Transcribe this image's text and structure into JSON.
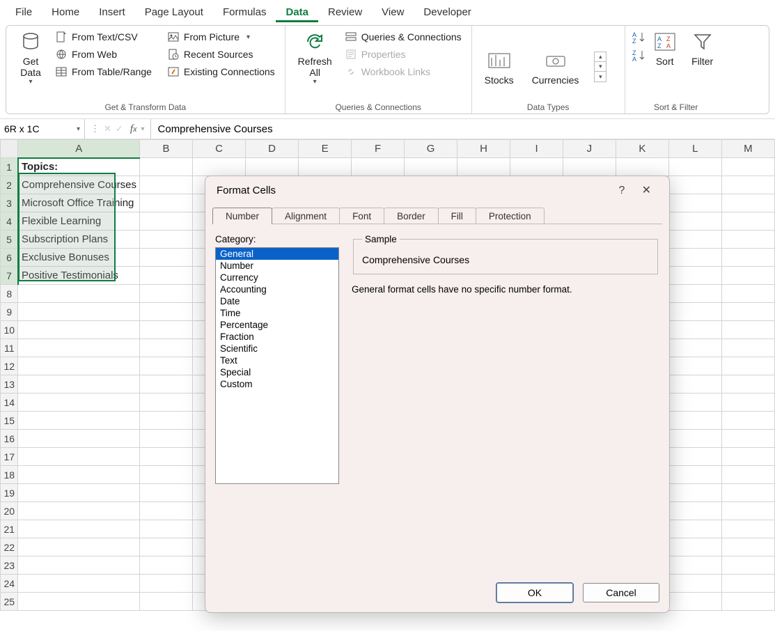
{
  "ribbon": {
    "tabs": [
      "File",
      "Home",
      "Insert",
      "Page Layout",
      "Formulas",
      "Data",
      "Review",
      "View",
      "Developer"
    ],
    "active_tab": "Data",
    "groups": {
      "get_transform": {
        "label": "Get & Transform Data",
        "get_data": "Get\nData",
        "from_text_csv": "From Text/CSV",
        "from_web": "From Web",
        "from_table_range": "From Table/Range",
        "from_picture": "From Picture",
        "recent_sources": "Recent Sources",
        "existing_connections": "Existing Connections"
      },
      "queries_conn": {
        "label": "Queries & Connections",
        "refresh_all": "Refresh\nAll",
        "queries_connections": "Queries & Connections",
        "properties": "Properties",
        "workbook_links": "Workbook Links"
      },
      "data_types": {
        "label": "Data Types",
        "stocks": "Stocks",
        "currencies": "Currencies"
      },
      "sort_filter": {
        "label": "Sort & Filter",
        "sort": "Sort",
        "filter": "Filter"
      }
    }
  },
  "namebox": {
    "value": "6R x 1C"
  },
  "formula_bar": {
    "value": "Comprehensive Courses"
  },
  "grid": {
    "columns": [
      "A",
      "B",
      "C",
      "D",
      "E",
      "F",
      "G",
      "H",
      "I",
      "J",
      "K",
      "L",
      "M"
    ],
    "row_count": 25,
    "data": {
      "A1": "Topics:",
      "A2": "Comprehensive Courses",
      "A3": "Microsoft Office Training",
      "A4": "Flexible Learning",
      "A5": "Subscription Plans",
      "A6": "Exclusive Bonuses",
      "A7": "Positive Testimonials"
    }
  },
  "dialog": {
    "title": "Format Cells",
    "tabs": [
      "Number",
      "Alignment",
      "Font",
      "Border",
      "Fill",
      "Protection"
    ],
    "active_tab": "Number",
    "category_label": "Category:",
    "categories": [
      "General",
      "Number",
      "Currency",
      "Accounting",
      "Date",
      "Time",
      "Percentage",
      "Fraction",
      "Scientific",
      "Text",
      "Special",
      "Custom"
    ],
    "selected_category": "General",
    "sample_legend": "Sample",
    "sample_value": "Comprehensive Courses",
    "description": "General format cells have no specific number format.",
    "ok": "OK",
    "cancel": "Cancel",
    "help": "?",
    "close": "✕"
  }
}
